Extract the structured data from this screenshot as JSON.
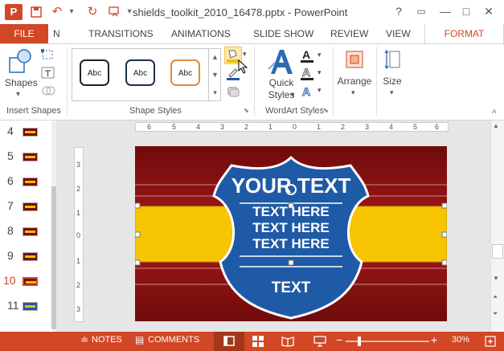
{
  "app": {
    "doc_title": "shields_toolkit_2010_16478.pptx - PowerPoint",
    "logo_letter": "P"
  },
  "window": {
    "help": "?",
    "restore": "▭",
    "minimize": "—",
    "maximize": "□",
    "close": "✕"
  },
  "tabs": {
    "file": "FILE",
    "items": [
      "N",
      "TRANSITIONS",
      "ANIMATIONS",
      "SLIDE SHOW",
      "REVIEW",
      "VIEW"
    ],
    "active": "FORMAT"
  },
  "ribbon": {
    "insert_shapes": {
      "label": "Insert Shapes",
      "shapes_button": "Shapes"
    },
    "shape_styles": {
      "label": "Shape Styles",
      "presets": [
        "Abc",
        "Abc",
        "Abc"
      ]
    },
    "wordart_styles": {
      "label": "WordArt Styles",
      "quick_styles_line1": "Quick",
      "quick_styles_line2": "Styles"
    },
    "arrange": {
      "label": "Arrange"
    },
    "size": {
      "label": "Size"
    }
  },
  "thumbnails": {
    "items": [
      {
        "num": "4"
      },
      {
        "num": "5"
      },
      {
        "num": "6"
      },
      {
        "num": "7"
      },
      {
        "num": "8"
      },
      {
        "num": "9"
      },
      {
        "num": "10"
      },
      {
        "num": "11"
      }
    ],
    "selected": "10"
  },
  "ruler": {
    "horizontal": [
      "6",
      "5",
      "4",
      "3",
      "2",
      "1",
      "0",
      "1",
      "2",
      "3",
      "4",
      "5",
      "6"
    ],
    "vertical": [
      "3",
      "2",
      "1",
      "0",
      "1",
      "2",
      "3"
    ]
  },
  "slide": {
    "title": "YOUR TEXT",
    "lines": [
      "TEXT HERE",
      "TEXT HERE",
      "TEXT HERE"
    ],
    "footer": "TEXT"
  },
  "statusbar": {
    "notes": "NOTES",
    "comments": "COMMENTS",
    "zoom": "30%"
  },
  "colors": {
    "accent": "#d24726",
    "slide_background": "#8e0f10",
    "banner": "#f6c400",
    "shield_fill": "#1f5aa6",
    "shield_border": "#ffffff"
  }
}
